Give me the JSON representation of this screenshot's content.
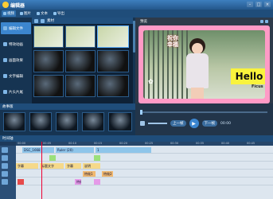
{
  "app": {
    "title": "编辑器"
  },
  "toolbar": {
    "items": [
      "视频",
      "图片",
      "文本",
      "导出"
    ]
  },
  "sidebar": {
    "items": [
      "编辑文件",
      "特效动画",
      "画面效果",
      "文字编辑",
      "片头片尾"
    ]
  },
  "library": {
    "label": "素材"
  },
  "preview": {
    "tab": "预览",
    "blessing_text": "祝你幸福",
    "hello_text": "Hello",
    "hello_sub": "Ficus"
  },
  "storyboard": {
    "label": "故事版"
  },
  "controls": {
    "prev_label": "上一帧",
    "next_label": "下一帧",
    "time": "00:00"
  },
  "timeline": {
    "label": "时间轴",
    "ruler": [
      "00:00",
      "00:05",
      "00:10",
      "00:15",
      "00:20",
      "00:25",
      "00:30",
      "00:35",
      "00:40",
      "00:45"
    ],
    "clips": {
      "video1": "DSC_1668",
      "video2": "Ruler (20)",
      "video3": "1",
      "t1": "字幕",
      "t2": "标题文字",
      "t3": "字幕",
      "t4": "说明",
      "e1": "特效1",
      "e2": "特效2",
      "e3": "特效3"
    }
  },
  "colors": {
    "accent": "#3c86cf",
    "stage_border": "#ff9ac6",
    "hello_bg": "#f9f33c"
  }
}
